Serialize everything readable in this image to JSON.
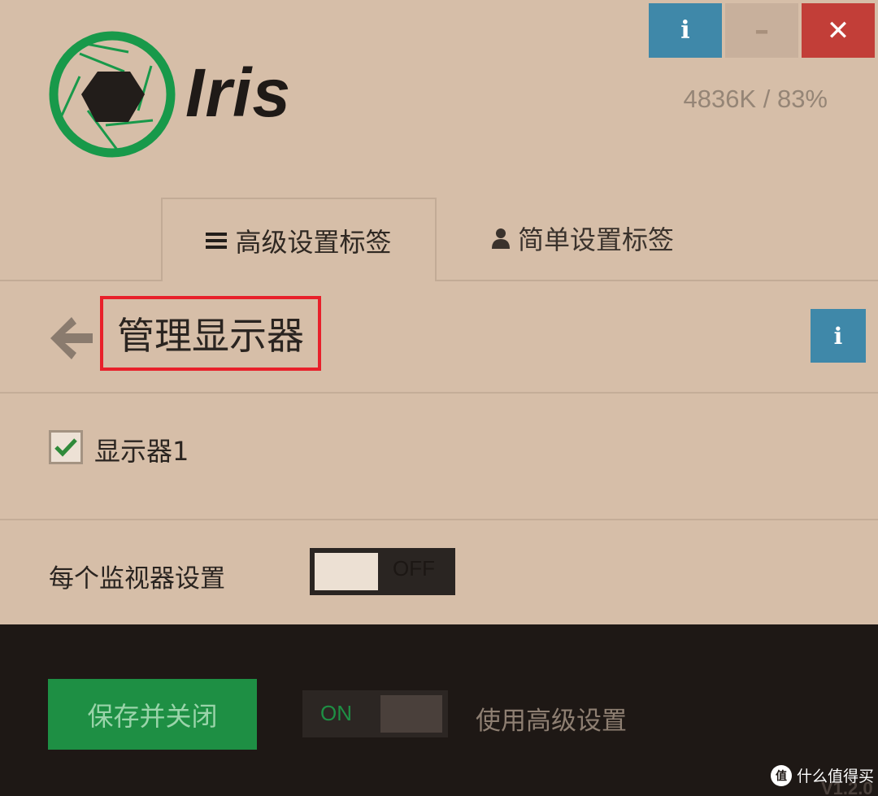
{
  "app": {
    "name": "Iris",
    "stats": "4836K / 83%",
    "version": "V1.2.0"
  },
  "window_controls": {
    "info_glyph": "i",
    "minimize_glyph": "–",
    "close_glyph": "✕"
  },
  "tabs": [
    {
      "label": "高级设置标签",
      "icon": "hamburger-icon",
      "active": true
    },
    {
      "label": "简单设置标签",
      "icon": "user-icon",
      "active": false
    }
  ],
  "section": {
    "title": "管理显示器",
    "info_glyph": "i"
  },
  "monitors": [
    {
      "label": "显示器1",
      "checked": true
    }
  ],
  "per_monitor": {
    "label": "每个监视器设置",
    "toggle_text": "OFF"
  },
  "footer": {
    "save_label": "保存并关闭",
    "toggle_text": "ON",
    "advanced_label": "使用高级设置"
  },
  "watermark": {
    "text": "什么值得买",
    "glyph": "值"
  },
  "colors": {
    "background": "#d6bea8",
    "footer": "#1e1815",
    "accent_blue": "#3f88a9",
    "close_red": "#c23e38",
    "save_green": "#1e8f44",
    "highlight_red": "#e8202a"
  }
}
